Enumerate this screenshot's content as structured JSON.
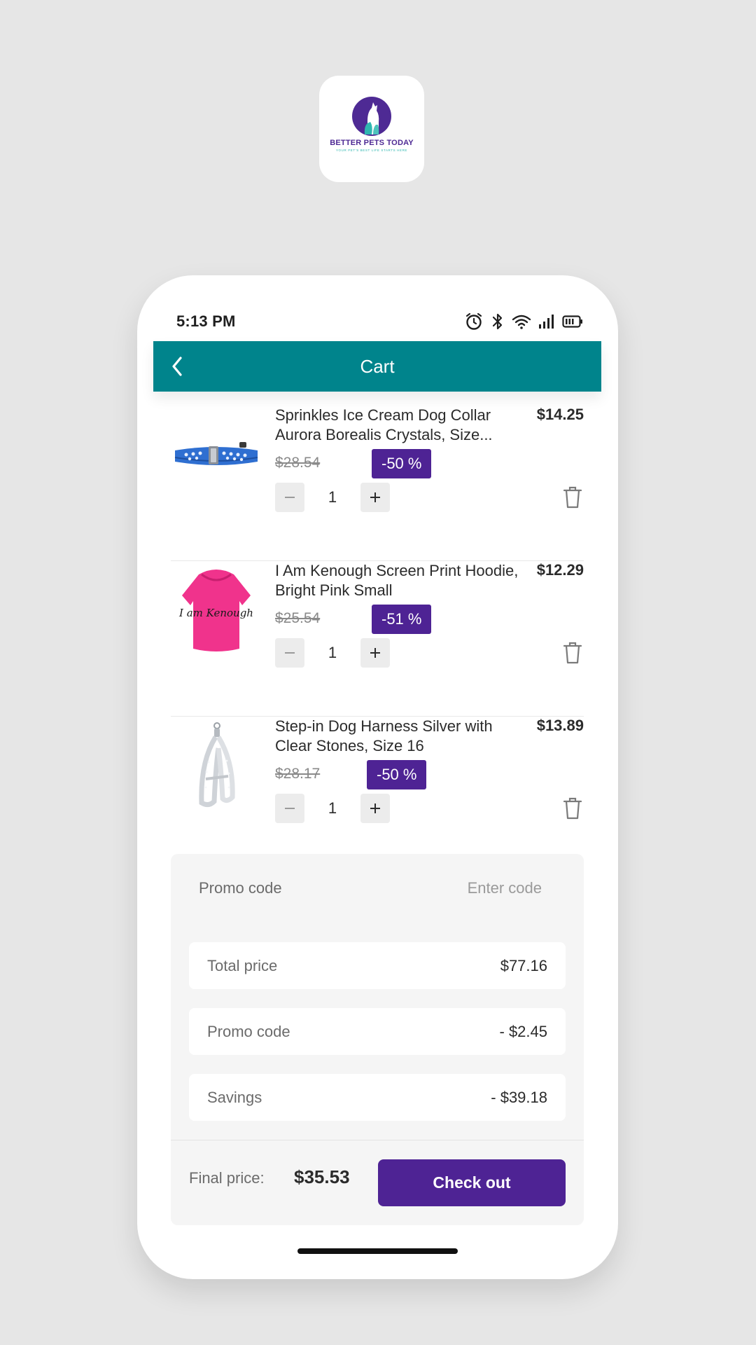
{
  "brand": {
    "name": "BETTER PETS TODAY",
    "tagline": "YOUR PET'S BEST LIFE STARTS HERE",
    "primary_color": "#4e2a94",
    "accent_color": "#2fb7b0"
  },
  "status_bar": {
    "time": "5:13 PM",
    "icons": [
      "alarm-icon",
      "bluetooth-icon",
      "wifi-icon",
      "signal-icon",
      "battery-icon"
    ]
  },
  "header": {
    "title": "Cart",
    "back_icon": "chevron-left-icon",
    "color": "#00848c"
  },
  "cart": {
    "items": [
      {
        "name": "Sprinkles Ice Cream Dog Collar Aurora Borealis Crystals, Size...",
        "price": "$14.25",
        "old_price": "$28.54",
        "discount": "-50 %",
        "quantity": "1",
        "image": "blue-dog-collar"
      },
      {
        "name": "I Am Kenough Screen Print Hoodie, Bright Pink Small",
        "price": "$12.29",
        "old_price": "$25.54",
        "discount": "-51 %",
        "quantity": "1",
        "image": "pink-dog-hoodie",
        "image_text": "I am Kenough"
      },
      {
        "name": "Step-in Dog Harness Silver with Clear Stones, Size 16",
        "price": "$13.89",
        "old_price": "$28.17",
        "discount": "-50 %",
        "quantity": "1",
        "image": "silver-dog-harness"
      }
    ]
  },
  "summary": {
    "promo_label": "Promo code",
    "promo_placeholder": "Enter code",
    "rows": [
      {
        "label": "Total price",
        "value": "$77.16"
      },
      {
        "label": "Promo code",
        "value": "- $2.45"
      },
      {
        "label": "Savings",
        "value": "- $39.18"
      }
    ],
    "final_label": "Final price:",
    "final_value": "$35.53",
    "checkout_label": "Check out",
    "button_color": "#4e2394"
  }
}
